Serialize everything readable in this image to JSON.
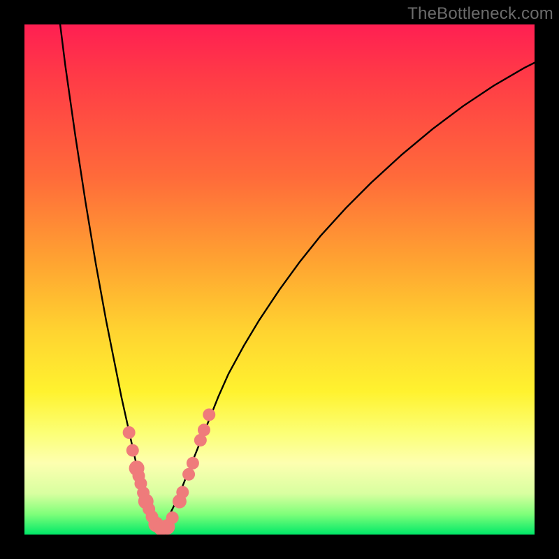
{
  "watermark": "TheBottleneck.com",
  "colors": {
    "frame": "#000000",
    "curve": "#000000",
    "dot_fill": "#ef7b7b",
    "dot_stroke": "#e06868"
  },
  "chart_data": {
    "type": "line",
    "title": "",
    "xlabel": "",
    "ylabel": "",
    "xlim": [
      0,
      100
    ],
    "ylim": [
      0,
      100
    ],
    "series": [
      {
        "name": "left-branch",
        "x": [
          7,
          8,
          9,
          10,
          11,
          12,
          13,
          14,
          15,
          16,
          17,
          18,
          19,
          20,
          21,
          22,
          23,
          24,
          25,
          26
        ],
        "values": [
          100,
          92,
          85,
          78,
          71.5,
          65,
          59,
          53,
          47.5,
          42,
          37,
          32,
          27,
          22.5,
          18,
          13.5,
          9.5,
          6,
          3,
          1
        ]
      },
      {
        "name": "right-branch",
        "x": [
          27,
          28,
          30,
          32,
          34,
          36,
          38,
          40,
          43,
          46,
          50,
          54,
          58,
          63,
          68,
          74,
          80,
          86,
          92,
          98,
          100
        ],
        "values": [
          1,
          3,
          7,
          12,
          17,
          22,
          27,
          31.5,
          37,
          42,
          48,
          53.5,
          58.5,
          64,
          69,
          74.5,
          79.5,
          84,
          88,
          91.5,
          92.5
        ]
      }
    ],
    "points": {
      "name": "highlighted-dots",
      "x": [
        20.5,
        21.2,
        22.0,
        22.4,
        22.8,
        23.3,
        23.8,
        24.4,
        25.0,
        25.8,
        26.8,
        28.0,
        29.0,
        30.4,
        31.0,
        32.2,
        33.0,
        34.5,
        35.2,
        36.2
      ],
      "y": [
        20.0,
        16.5,
        13.0,
        11.5,
        10.0,
        8.2,
        6.5,
        5.0,
        3.5,
        2.0,
        1.3,
        1.5,
        3.3,
        6.5,
        8.3,
        11.8,
        14.0,
        18.5,
        20.5,
        23.5
      ],
      "r": [
        9,
        9,
        11,
        9,
        9,
        9,
        11,
        9,
        9,
        11,
        11,
        11,
        9,
        10,
        9,
        9,
        9,
        9,
        9,
        9
      ]
    }
  }
}
